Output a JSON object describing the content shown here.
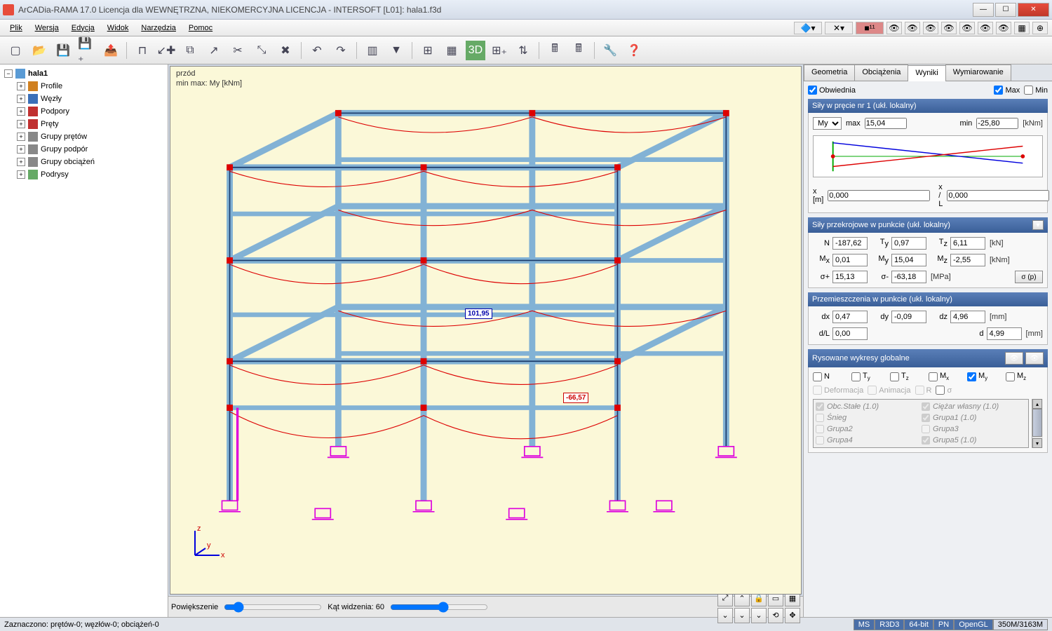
{
  "title": "ArCADia-RAMA 17.0 Licencja dla WEWNĘTRZNA, NIEKOMERCYJNA LICENCJA - INTERSOFT [L01]: hala1.f3d",
  "menu": {
    "plik": "Plik",
    "wersja": "Wersja",
    "edycja": "Edycja",
    "widok": "Widok",
    "narzedzia": "Narzędzia",
    "pomoc": "Pomoc"
  },
  "tree": {
    "root": "hala1",
    "items": [
      {
        "label": "Profile",
        "color": "#d08020"
      },
      {
        "label": "Węzły",
        "color": "#3a6fb8"
      },
      {
        "label": "Podpory",
        "color": "#c03030"
      },
      {
        "label": "Pręty",
        "color": "#c03030"
      },
      {
        "label": "Grupy prętów",
        "color": "#888"
      },
      {
        "label": "Grupy podpór",
        "color": "#888"
      },
      {
        "label": "Grupy obciążeń",
        "color": "#888"
      },
      {
        "label": "Podrysy",
        "color": "#66aa66"
      }
    ]
  },
  "viewport": {
    "topLabel": "przód",
    "subLabel": "min max: My [kNm]",
    "annot1": "101,95",
    "annot2": "-66,57",
    "powiekszenie": "Powiększenie",
    "kat": "Kąt widzenia: 60"
  },
  "tabs": {
    "geom": "Geometria",
    "obc": "Obciążenia",
    "wyn": "Wyniki",
    "wym": "Wymiarowanie"
  },
  "panel": {
    "obwiednia": "Obwiednia",
    "max": "Max",
    "min": "Min",
    "sec1": "Siły w pręcie nr 1 (ukł. lokalny)",
    "my_opt": "My",
    "maxLbl": "max",
    "maxVal": "15,04",
    "minLbl": "min",
    "minVal": "-25,80",
    "kNm": "[kNm]",
    "xm": "x [m]",
    "xmVal": "0,000",
    "xL": "x / L",
    "xLVal": "0,000",
    "sec2": "Siły przekrojowe w punkcie (ukł. lokalny)",
    "N": "N",
    "NVal": "-187,62",
    "Ty": "Ty",
    "TyVal": "0,97",
    "Tz": "Tz",
    "TzVal": "6,11",
    "kN": "[kN]",
    "Mx": "Mx",
    "MxVal": "0,01",
    "My": "My",
    "MyVal": "15,04",
    "Mz": "Mz",
    "MzVal": "-2,55",
    "sp": "σ+",
    "spVal": "15,13",
    "sm": "σ-",
    "smVal": "-63,18",
    "MPa": "[MPa]",
    "sigmaBtn": "σ (p)",
    "sec3": "Przemieszczenia w punkcie (ukł. lokalny)",
    "dx": "dx",
    "dxVal": "0,47",
    "dy": "dy",
    "dyVal": "-0,09",
    "dz": "dz",
    "dzVal": "4,96",
    "mm": "[mm]",
    "dL": "d/L",
    "dLVal": "0,00",
    "d": "d",
    "dVal": "4,99",
    "sec4": "Rysowane wykresy globalne",
    "deform": "Deformacja",
    "anim": "Animacja",
    "R": "R",
    "sigma": "σ",
    "loads": [
      "Obc.Stałe (1.0)",
      "Ciężar własny (1.0)",
      "Śnieg",
      "Grupa1 (1.0)",
      "Grupa2",
      "Grupa3",
      "Grupa4",
      "Grupa5 (1.0)"
    ]
  },
  "statusbar": {
    "left": "Zaznaczono: prętów-0; węzłów-0; obciążeń-0",
    "MS": "MS",
    "R3D3": "R3D3",
    "bit": "64-bit",
    "PN": "PN",
    "OpenGL": "OpenGL",
    "mem": "350M/3163M"
  }
}
